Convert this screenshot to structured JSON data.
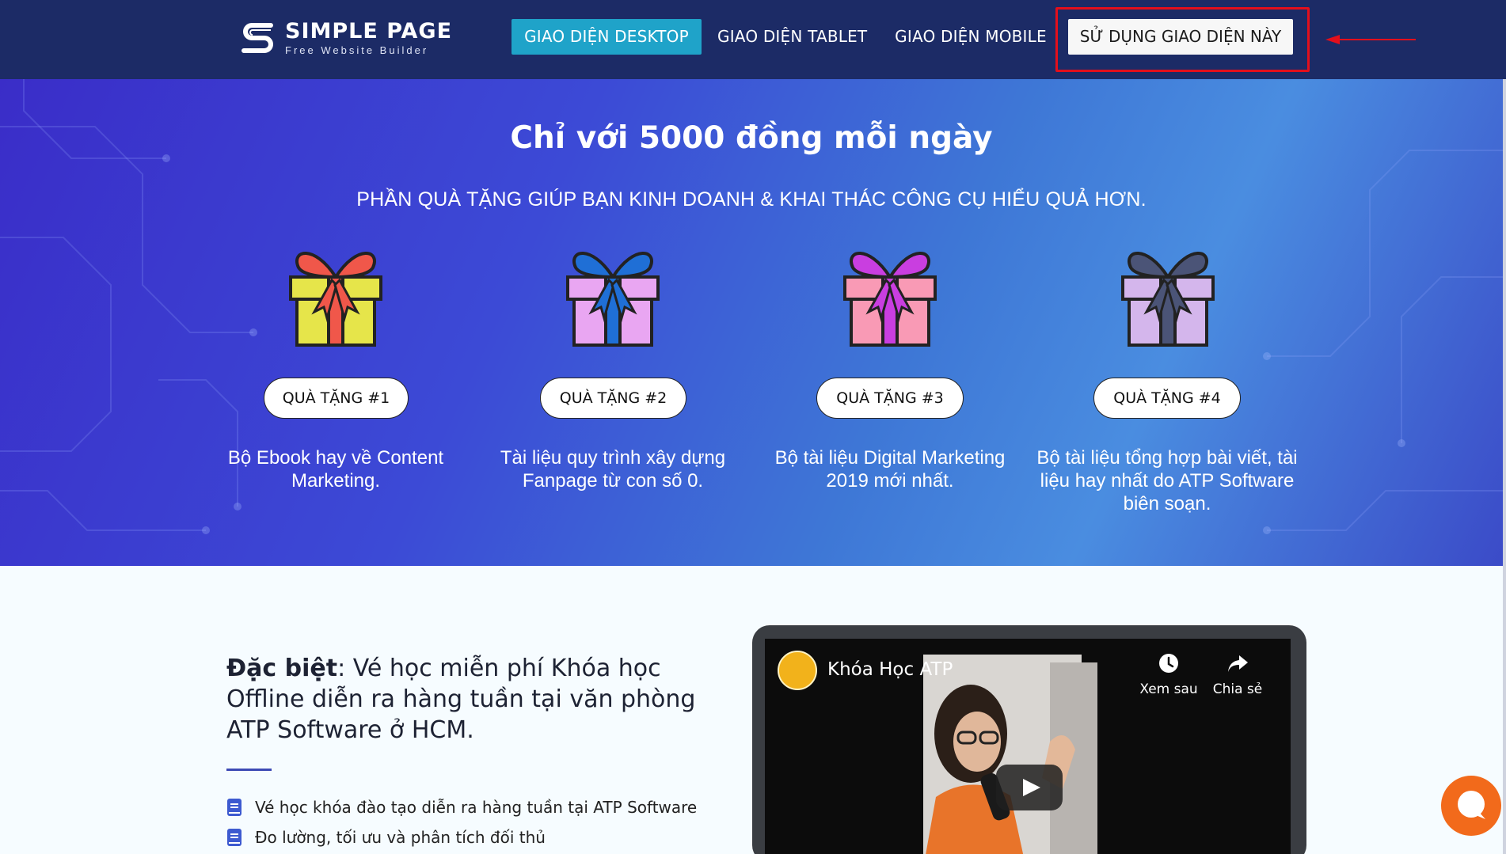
{
  "header": {
    "logo_title": "SIMPLE PAGE",
    "logo_subtitle": "Free Website Builder",
    "nav": {
      "desktop": "GIAO DIỆN DESKTOP",
      "tablet": "GIAO DIỆN TABLET",
      "mobile": "GIAO DIỆN MOBILE",
      "use": "SỬ DỤNG GIAO DIỆN NÀY"
    },
    "highlight_color": "#e30f1b"
  },
  "hero": {
    "title": "Chỉ với 5000 đồng mỗi ngày",
    "subtitle": "PHẦN QUÀ TẶNG GIÚP BẠN KINH DOANH & KHAI THÁC CÔNG CỤ HIỂU QUẢ HƠN.",
    "gifts": [
      {
        "label": "QUÀ TẶNG #1",
        "desc": "Bộ Ebook hay về Content Marketing.",
        "icon": "gift-icon",
        "box_color": "#e6e54a",
        "bow_color": "#f0574a"
      },
      {
        "label": "QUÀ TẶNG #2",
        "desc": "Tài liệu quy trình xây dựng Fanpage từ con số 0.",
        "icon": "gift-icon",
        "box_color": "#e9a6f2",
        "bow_color": "#1f6fd6"
      },
      {
        "label": "QUÀ TẶNG #3",
        "desc": "Bộ tài liệu Digital Marketing 2019 mới nhất.",
        "icon": "gift-icon",
        "box_color": "#f99ab5",
        "bow_color": "#c93ee0"
      },
      {
        "label": "QUÀ TẶNG #4",
        "desc": "Bộ tài liệu tổng hợp bài viết, tài liệu hay nhất do ATP Software biên soạn.",
        "icon": "gift-icon",
        "box_color": "#d4b6ec",
        "bow_color": "#4b5477"
      }
    ]
  },
  "special": {
    "lead": "Đặc biệt",
    "text": ": Vé học miễn phí Khóa học Offline diễn ra hàng tuần tại văn phòng ATP Software ở HCM.",
    "features": [
      "Vé học khóa đào tạo diễn ra hàng tuần tại ATP Software",
      "Đo lường, tối ưu và phân tích đối thủ"
    ]
  },
  "video": {
    "title": "Khóa Học ATP",
    "watch_later": "Xem sau",
    "share": "Chia sẻ"
  }
}
